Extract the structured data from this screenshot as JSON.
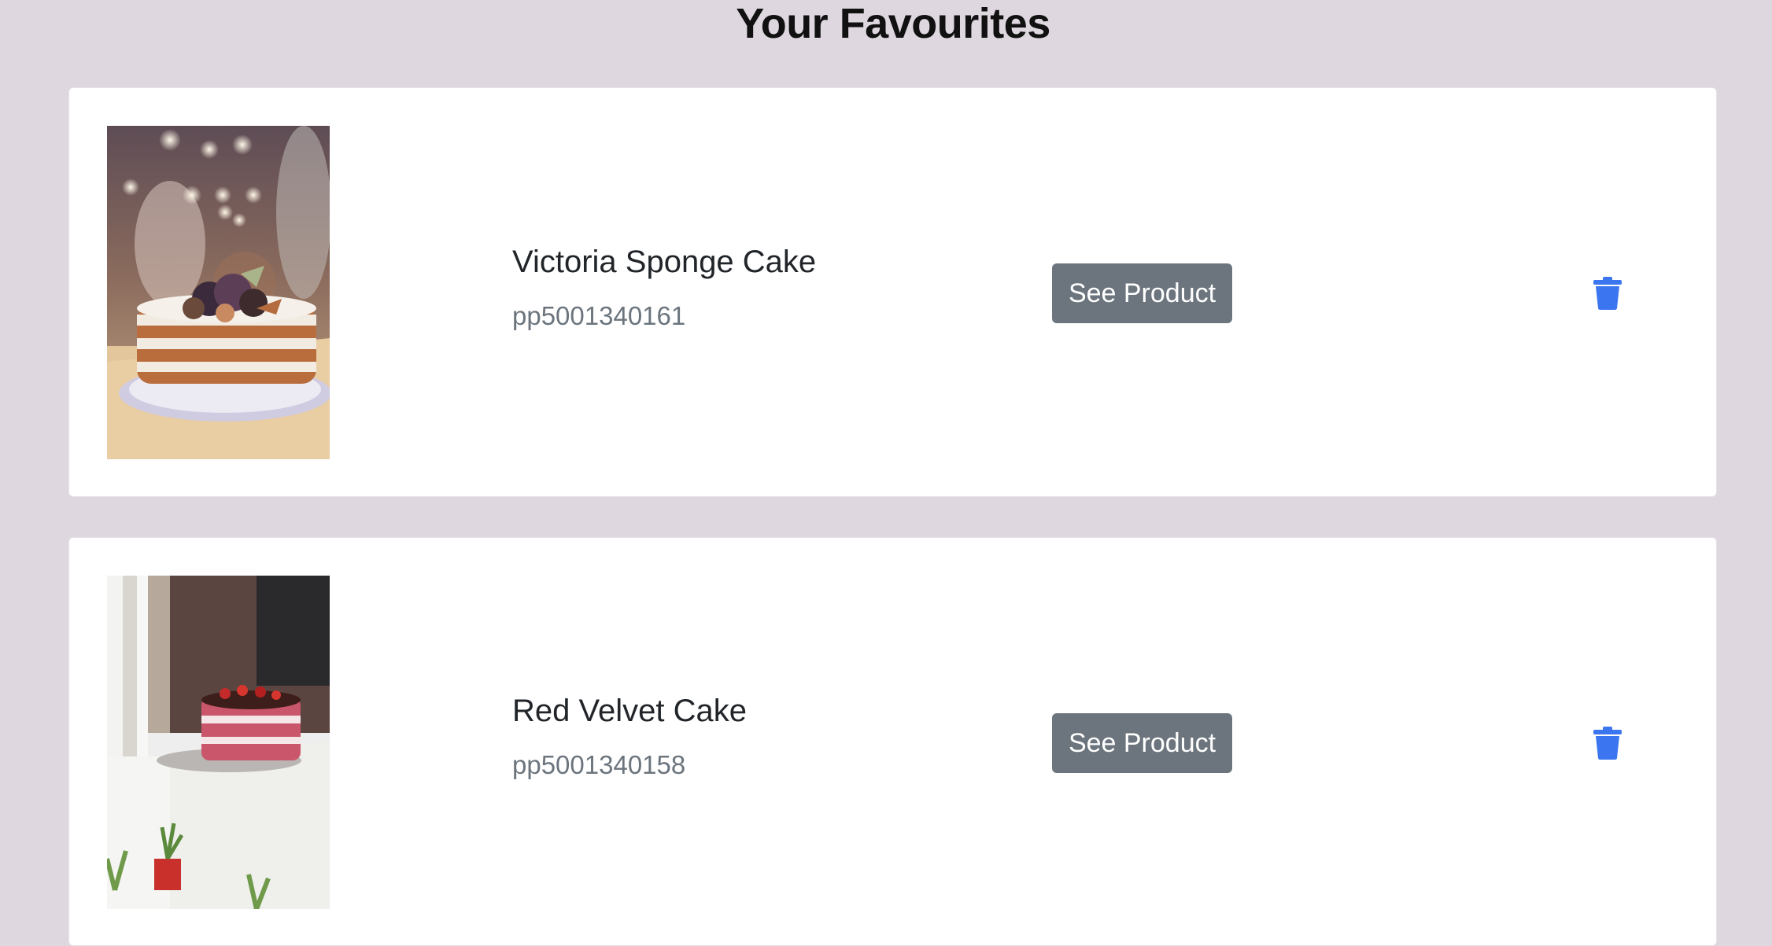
{
  "page": {
    "title": "Your Favourites"
  },
  "favourites": [
    {
      "name": "Victoria Sponge Cake",
      "sku": "pp5001340161",
      "button_label": "See Product",
      "image_icon": "cake-photo",
      "delete_icon": "trash-icon"
    },
    {
      "name": "Red Velvet Cake",
      "sku": "pp5001340158",
      "button_label": "See Product",
      "image_icon": "cake-photo",
      "delete_icon": "trash-icon"
    }
  ],
  "colors": {
    "background": "#ded7df",
    "card": "#ffffff",
    "button": "#6c757d",
    "trash_icon": "#3b76f0",
    "sku_text": "#6c757d"
  }
}
